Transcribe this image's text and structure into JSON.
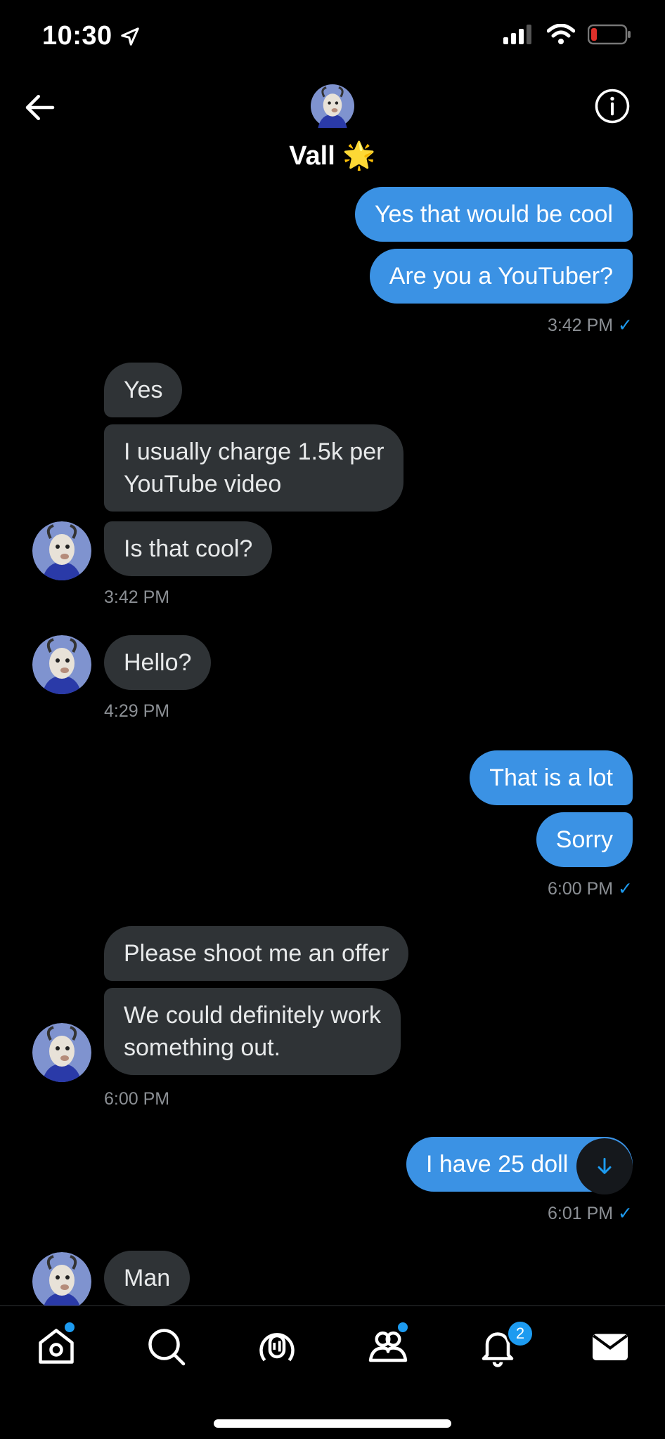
{
  "status": {
    "time": "10:30"
  },
  "header": {
    "name": "Vall",
    "emoji": "🌟"
  },
  "messages": [
    {
      "text": "Yes that would be cool"
    },
    {
      "text": "Are you a YouTuber?"
    },
    {
      "time": "3:42 PM",
      "check": "✓"
    },
    {
      "text": "Yes"
    },
    {
      "text_line1": "I usually charge 1.5k per",
      "text_line2": "YouTube video"
    },
    {
      "text": "Is that cool?"
    },
    {
      "time": "3:42 PM"
    },
    {
      "text": "Hello?"
    },
    {
      "time": "4:29 PM"
    },
    {
      "text": "That is a lot"
    },
    {
      "text": "Sorry"
    },
    {
      "time": "6:00 PM",
      "check": "✓"
    },
    {
      "text": "Please shoot me an offer"
    },
    {
      "text_line1": "We could definitely work",
      "text_line2": "something out."
    },
    {
      "time": "6:00 PM"
    },
    {
      "text": "I have 25 doll"
    },
    {
      "time": "6:01 PM",
      "check": "✓"
    },
    {
      "text": "Man"
    }
  ],
  "nav": {
    "notifications_badge": "2"
  },
  "icons": [
    "back-arrow-icon",
    "info-icon",
    "home-icon",
    "search-icon",
    "spaces-icon",
    "communities-icon",
    "bell-icon",
    "mail-icon",
    "scroll-down-icon"
  ]
}
